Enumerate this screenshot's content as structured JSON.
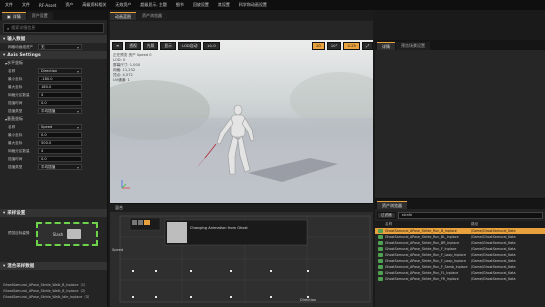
{
  "menu": [
    "文件",
    "文件",
    "RF-Asset",
    "资产",
    "高级资料相关",
    "无效资产",
    "超级显示, 主题",
    "细节",
    "回放设置",
    "其设置",
    "科学和动画设置"
  ],
  "left": {
    "tabs": [
      {
        "label": "详情"
      },
      {
        "label": "资产设置"
      }
    ],
    "search_placeholder": "搜索详细信息",
    "section_input": "输入数据",
    "input_rows": [
      {
        "label": "网格动画组资产",
        "value": "无"
      }
    ],
    "section_axis": "Axis Settings",
    "axis_x": {
      "title": "水平坐标",
      "rows": [
        {
          "label": "名称",
          "value": "Direction"
        },
        {
          "label": "最小坐标",
          "value": "-180.0"
        },
        {
          "label": "最大坐标",
          "value": "180.0"
        },
        {
          "label": "网格分区数量",
          "value": "4"
        },
        {
          "label": "插值时间",
          "value": "0.0"
        },
        {
          "label": "插值类型",
          "value": "平均插值"
        }
      ]
    },
    "axis_y": {
      "title": "垂直坐标",
      "rows": [
        {
          "label": "名称",
          "value": "Speed"
        },
        {
          "label": "最小坐标",
          "value": "0.0"
        },
        {
          "label": "最大坐标",
          "value": "500.0"
        },
        {
          "label": "网格分区数量",
          "value": "4"
        },
        {
          "label": "插值时间",
          "value": "0.0"
        },
        {
          "label": "插值类型",
          "value": "平均插值"
        }
      ]
    },
    "section_samples": "采样设置",
    "preview_label": "预览目标姿势",
    "preview_text": "Slash",
    "section_anims": "混合采样数据",
    "anim_items": [
      "GhostSamurai_APose_Stride_Walk_B_Inplace（1）",
      "GhostSamurai_APose_Stride_Walk_B_Inplace（2）",
      "GhostSamurai_APose_Stride_Walk_Idle_Inplace（3）"
    ]
  },
  "tabbar_top": {
    "tab1": "动画蓝图",
    "tab2": "资产浏览器"
  },
  "viewport": {
    "buttons": [
      "透视",
      "光照",
      "显示",
      "LOD自动",
      "x1.0"
    ],
    "grid_values": [
      "10",
      "10°",
      "0.25"
    ],
    "info": [
      "正在预览 资产 Speed 0",
      "LOD: 0",
      "屏幕尺寸: 1.000",
      "网格: 11,232",
      "顶点: 4,572",
      "UV通道: 1"
    ]
  },
  "timeline": {
    "header": "混合",
    "axis_x_label": "Direction",
    "axis_y_label": "Speed",
    "tooltip": "Changing Animation from Ghost"
  },
  "right_top": {
    "tabs": [
      {
        "label": "详情"
      },
      {
        "label": "预览场景设置"
      }
    ]
  },
  "browser": {
    "tab": "资产浏览器",
    "filter": "过滤器",
    "search": "strafe",
    "columns": [
      "名称",
      "路径"
    ],
    "rows": [
      {
        "name": "GhostSamurai_APose_Stride_Run_B_Inplace",
        "path": "/Game/GhostSamurai_Kata",
        "selected": true
      },
      {
        "name": "GhostSamurai_APose_Stride_Run_BL_Inplace",
        "path": "/Game/GhostSamurai_Kata",
        "selected": false
      },
      {
        "name": "GhostSamurai_APose_Stride_Run_BR_Inplace",
        "path": "/Game/GhostSamurai_Kata",
        "selected": false
      },
      {
        "name": "GhostSamurai_APose_Stride_Run_F_Inplace",
        "path": "/Game/GhostSamurai_Kata",
        "selected": false
      },
      {
        "name": "GhostSamurai_APose_Stride_Run_F_Loop_Inplace",
        "path": "/Game/GhostSamurai_Kata",
        "selected": false
      },
      {
        "name": "GhostSamurai_APose_Stride_Run_F_Loop_Inplace",
        "path": "/Game/GhostSamurai_Kata",
        "selected": false
      },
      {
        "name": "GhostSamurai_APose_Stride_Run_F_Samb_Inplace",
        "path": "/Game/GhostSamurai_Kata",
        "selected": false
      },
      {
        "name": "GhostSamurai_APose_Stride_Run_FL_Inplace",
        "path": "/Game/GhostSamurai_Kata",
        "selected": false
      },
      {
        "name": "GhostSamurai_APose_Stride_Run_FR_Inplace",
        "path": "/Game/GhostSamurai_Kata",
        "selected": false
      }
    ]
  },
  "colors": {
    "accent": "#e8a13c",
    "selection_green": "#6cd34a",
    "anim_icon": "#4fa24f"
  }
}
